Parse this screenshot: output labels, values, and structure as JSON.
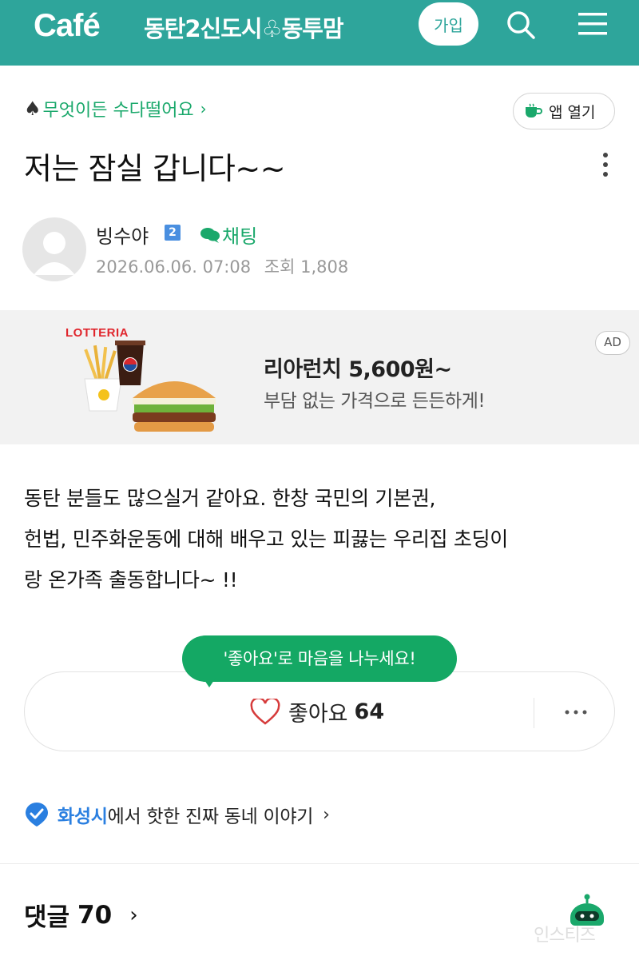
{
  "header": {
    "logo": "Café",
    "cafe_name": "동탄2신도시♧동투맘",
    "join_label": "가입",
    "search_icon": "search-icon",
    "menu_icon": "menu-icon",
    "background": "#2ea59b"
  },
  "board": {
    "spade": "♠",
    "name": "무엇이든 수다떨어요",
    "chevron": "›"
  },
  "app_open": {
    "label": "앱 열기",
    "icon": "cup-icon"
  },
  "post": {
    "title": "저는 잠실 갑니다~~",
    "more_icon": "more-vertical-icon",
    "body_lines": [
      "동탄 분들도 많으실거 같아요. 한창 국민의 기본권,",
      "헌법, 민주화운동에 대해 배우고 있는 피끓는 우리집 초딩이",
      "랑 온가족 출동합니다~ !!"
    ]
  },
  "author": {
    "name": "빙수야",
    "level": "2",
    "chat_label": "채팅",
    "date": "2026.06.06. 07:08",
    "views_label": "조회",
    "views": "1,808"
  },
  "ad": {
    "brand": "LOTTERIA",
    "title": "리아런치 5,600원~",
    "description": "부담 없는 가격으로 든든하게!",
    "badge": "AD"
  },
  "like": {
    "bubble": "'좋아요'로 마음을 나누세요!",
    "label": "좋아요",
    "count": "64",
    "accent": "#14a864"
  },
  "local": {
    "city": "화성시",
    "text": "에서 핫한 진짜 동네 이야기",
    "chevron": "›"
  },
  "comments": {
    "label": "댓글",
    "count": "70",
    "chevron": "›"
  },
  "watermark": "인스티즈"
}
